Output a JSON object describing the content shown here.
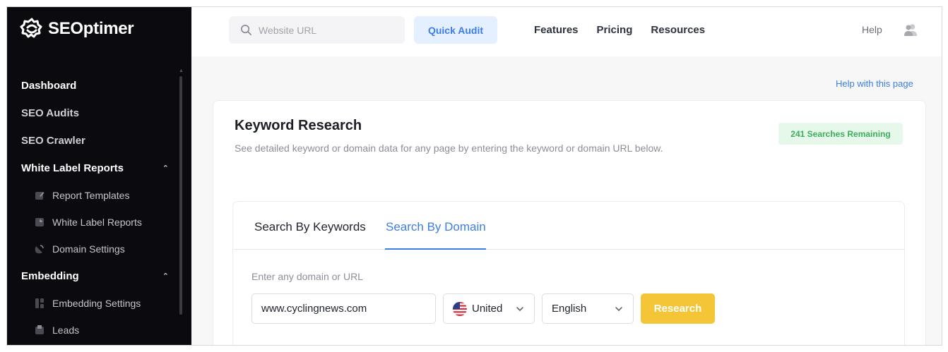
{
  "brand": {
    "name": "SEOptimer"
  },
  "sidebar": {
    "items": [
      {
        "label": "Dashboard"
      },
      {
        "label": "SEO Audits"
      },
      {
        "label": "SEO Crawler"
      }
    ],
    "groups": [
      {
        "label": "White Label Reports",
        "children": [
          {
            "label": "Report Templates",
            "icon": "edit-icon"
          },
          {
            "label": "White Label Reports",
            "icon": "report-icon"
          },
          {
            "label": "Domain Settings",
            "icon": "satellite-icon"
          }
        ]
      },
      {
        "label": "Embedding",
        "children": [
          {
            "label": "Embedding Settings",
            "icon": "embed-icon"
          },
          {
            "label": "Leads",
            "icon": "inbox-icon"
          }
        ]
      }
    ]
  },
  "topbar": {
    "search_placeholder": "Website URL",
    "quick_audit": "Quick Audit",
    "nav": [
      "Features",
      "Pricing",
      "Resources"
    ],
    "help": "Help"
  },
  "main": {
    "help_link": "Help with this page",
    "title": "Keyword Research",
    "subtitle": "See detailed keyword or domain data for any page by entering the keyword or domain URL below.",
    "badge": "241  Searches Remaining",
    "tabs": [
      {
        "label": "Search By Keywords",
        "active": false
      },
      {
        "label": "Search By Domain",
        "active": true
      }
    ],
    "field_label": "Enter any domain or URL",
    "domain_value": "www.cyclingnews.com",
    "country": "United",
    "language": "English",
    "research_button": "Research"
  },
  "colors": {
    "accent": "#3c7ee6",
    "sidebar_bg": "#0b0b0f",
    "badge_bg": "#e5f8ea",
    "badge_text": "#3cae5c",
    "research_button": "#f4c537"
  }
}
